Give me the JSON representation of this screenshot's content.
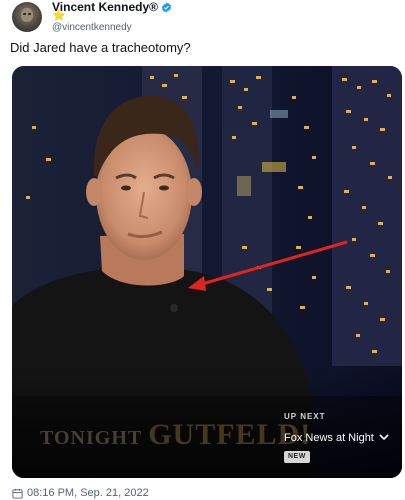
{
  "tweet": {
    "display_name": "Vincent Kennedy®",
    "verified_icon": "verified-badge-icon",
    "status_emoji": "⭐",
    "handle": "@vincentkennedy",
    "text": "Did Jared have a tracheotomy?",
    "timestamp": "08:16 PM, Sep. 21, 2022"
  },
  "video_overlay": {
    "show_logo_first": "TONIGHT",
    "show_logo_second": "GUTFELD!",
    "up_next_label": "UP NEXT",
    "up_next_title": "Fox News at Night",
    "badge": "NEW"
  },
  "colors": {
    "text_primary": "#0f1419",
    "text_secondary": "#536471",
    "verified_blue": "#1d9bf0",
    "arrow_red": "#e0261c"
  }
}
